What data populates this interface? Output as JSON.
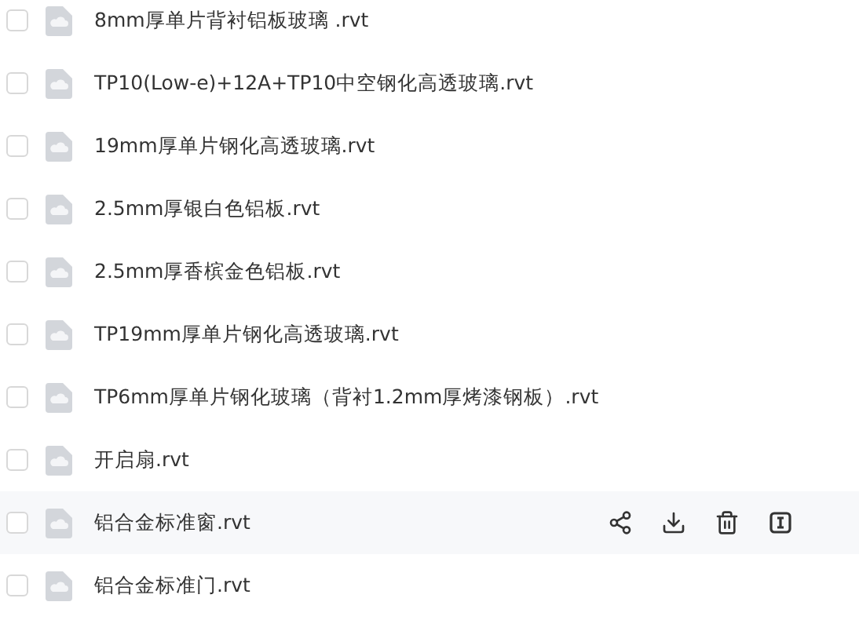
{
  "files": [
    {
      "name": "8mm厚单片背衬铝板玻璃 .rvt",
      "checked": false,
      "hovered": false
    },
    {
      "name": "TP10(Low-e)+12A+TP10中空钢化高透玻璃.rvt",
      "checked": false,
      "hovered": false
    },
    {
      "name": "19mm厚单片钢化高透玻璃.rvt",
      "checked": false,
      "hovered": false
    },
    {
      "name": "2.5mm厚银白色铝板.rvt",
      "checked": false,
      "hovered": false
    },
    {
      "name": "2.5mm厚香槟金色铝板.rvt",
      "checked": false,
      "hovered": false
    },
    {
      "name": "TP19mm厚单片钢化高透玻璃.rvt",
      "checked": false,
      "hovered": false
    },
    {
      "name": "TP6mm厚单片钢化玻璃（背衬1.2mm厚烤漆钢板）.rvt",
      "checked": false,
      "hovered": false
    },
    {
      "name": "开启扇.rvt",
      "checked": false,
      "hovered": false
    },
    {
      "name": "铝合金标准窗.rvt",
      "checked": false,
      "hovered": true
    },
    {
      "name": "铝合金标准门.rvt",
      "checked": false,
      "hovered": false
    }
  ]
}
